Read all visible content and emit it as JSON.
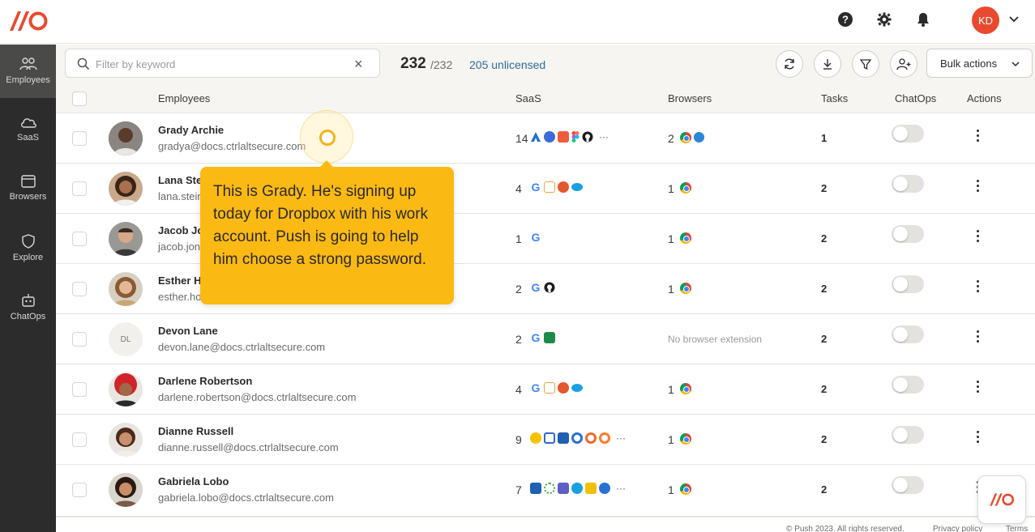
{
  "header": {
    "avatar_initials": "KD",
    "icons": [
      "help-icon",
      "gear-icon",
      "bell-icon",
      "chevron-down-icon"
    ],
    "brand_color": "#e84a2f"
  },
  "sidebar": {
    "items": [
      {
        "label": "Employees",
        "icon": "people-icon",
        "active": true
      },
      {
        "label": "SaaS",
        "icon": "cloud-icon"
      },
      {
        "label": "Browsers",
        "icon": "browser-icon"
      },
      {
        "label": "Explore",
        "icon": "shield-icon"
      },
      {
        "label": "ChatOps",
        "icon": "bot-icon"
      }
    ]
  },
  "toolbar": {
    "search_placeholder": "Filter by keyword",
    "count": "232",
    "count_total": "/232",
    "unlicensed": "205 unlicensed",
    "bulk_actions": "Bulk actions"
  },
  "table": {
    "headers": {
      "employees": "Employees",
      "saas": "SaaS",
      "browsers": "Browsers",
      "tasks": "Tasks",
      "chatops": "ChatOps",
      "actions": "Actions"
    },
    "rows": [
      {
        "name": "Grady Archie",
        "email": "gradya@docs.ctrlaltsecure.com",
        "saas": "14",
        "browsers": "2",
        "tasks": "1"
      },
      {
        "name": "Lana Ste",
        "email": "lana.stein",
        "saas": "4",
        "browsers": "1",
        "tasks": "2"
      },
      {
        "name": "Jacob Jo",
        "email": "jacob.jon",
        "saas": "1",
        "browsers": "1",
        "tasks": "2"
      },
      {
        "name": "Esther H",
        "email": "esther.ho",
        "saas": "2",
        "browsers": "1",
        "tasks": "2"
      },
      {
        "name": "Devon Lane",
        "email": "devon.lane@docs.ctrlaltsecure.com",
        "initials": "DL",
        "saas": "2",
        "browsers": "No browser extension",
        "tasks": "2"
      },
      {
        "name": "Darlene Robertson",
        "email": "darlene.robertson@docs.ctrlaltsecure.com",
        "saas": "4",
        "browsers": "1",
        "tasks": "2"
      },
      {
        "name": "Dianne Russell",
        "email": "dianne.russell@docs.ctrlaltsecure.com",
        "saas": "9",
        "browsers": "1",
        "tasks": "2"
      },
      {
        "name": "Gabriela Lobo",
        "email": "gabriela.lobo@docs.ctrlaltsecure.com",
        "saas": "7",
        "browsers": "1",
        "tasks": "2"
      }
    ]
  },
  "tooltip": {
    "text": "This is Grady. He's signing up today for Dropbox with his work account. Push is going to help him choose a strong password."
  },
  "footer": {
    "copyright": "© Push 2023. All rights reserved.",
    "privacy": "Privacy policy",
    "terms": "Terms"
  }
}
